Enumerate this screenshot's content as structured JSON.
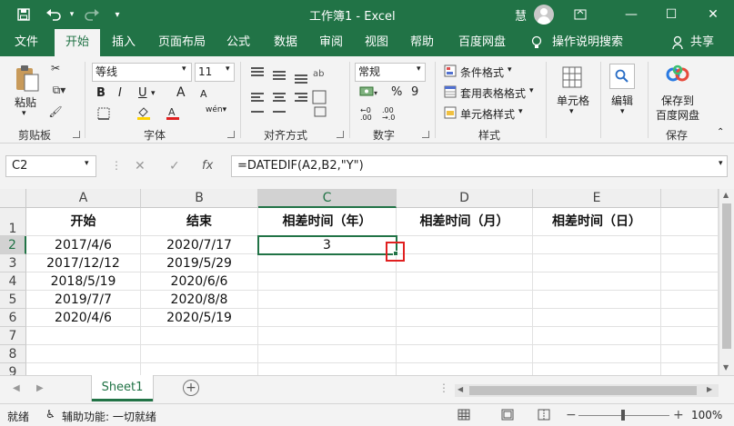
{
  "titlebar": {
    "title": "工作簿1  -  Excel",
    "user": "慧",
    "save_icon": "save-icon",
    "undo_icon": "undo-icon",
    "redo_icon": "redo-icon",
    "customize_icon": "customize-quick-access-icon"
  },
  "tabs": [
    "文件",
    "开始",
    "插入",
    "页面布局",
    "公式",
    "数据",
    "审阅",
    "视图",
    "帮助",
    "百度网盘",
    "操作说明搜索",
    "共享"
  ],
  "ribbon": {
    "clipboard": {
      "paste": "粘贴",
      "label": "剪贴板"
    },
    "font": {
      "name": "等线",
      "size": "11",
      "bold": "B",
      "italic": "I",
      "underline": "U",
      "grow": "A",
      "shrink": "A",
      "label": "字体"
    },
    "alignment": {
      "label": "对齐方式"
    },
    "number": {
      "format": "常规",
      "percent": "%",
      "comma": "9",
      "label": "数字"
    },
    "styles": {
      "conditional": "条件格式",
      "table": "套用表格格式",
      "cell": "单元格样式",
      "label": "样式"
    },
    "cells": {
      "label": "单元格"
    },
    "editing": {
      "label": "编辑"
    },
    "save": {
      "label_line1": "保存到",
      "label_line2": "百度网盘",
      "group": "保存"
    },
    "accent": "#217346"
  },
  "formula_bar": {
    "name_box": "C2",
    "cancel": "✕",
    "enter": "✓",
    "fx": "fx",
    "formula": "=DATEDIF(A2,B2,\"Y\")"
  },
  "grid": {
    "columns": [
      "A",
      "B",
      "C",
      "D",
      "E"
    ],
    "rows": [
      "1",
      "2",
      "3",
      "4",
      "5",
      "6",
      "7",
      "8",
      "9"
    ],
    "header_row": [
      "开始",
      "结束",
      "相差时间（年）",
      "相差时间（月）",
      "相差时间（日）"
    ],
    "data": [
      [
        "2017/4/6",
        "2020/7/17",
        "3",
        "",
        ""
      ],
      [
        "2017/12/12",
        "2019/5/29",
        "",
        "",
        ""
      ],
      [
        "2018/5/19",
        "2020/6/6",
        "",
        "",
        ""
      ],
      [
        "2019/7/7",
        "2020/8/8",
        "",
        "",
        ""
      ],
      [
        "2020/4/6",
        "2020/5/19",
        "",
        "",
        ""
      ]
    ],
    "active_cell": "C2"
  },
  "sheets": {
    "active": "Sheet1",
    "add_icon": "add-sheet-icon"
  },
  "status": {
    "ready": "就绪",
    "accessibility": "辅助功能: 一切就绪",
    "zoom": "100%"
  }
}
